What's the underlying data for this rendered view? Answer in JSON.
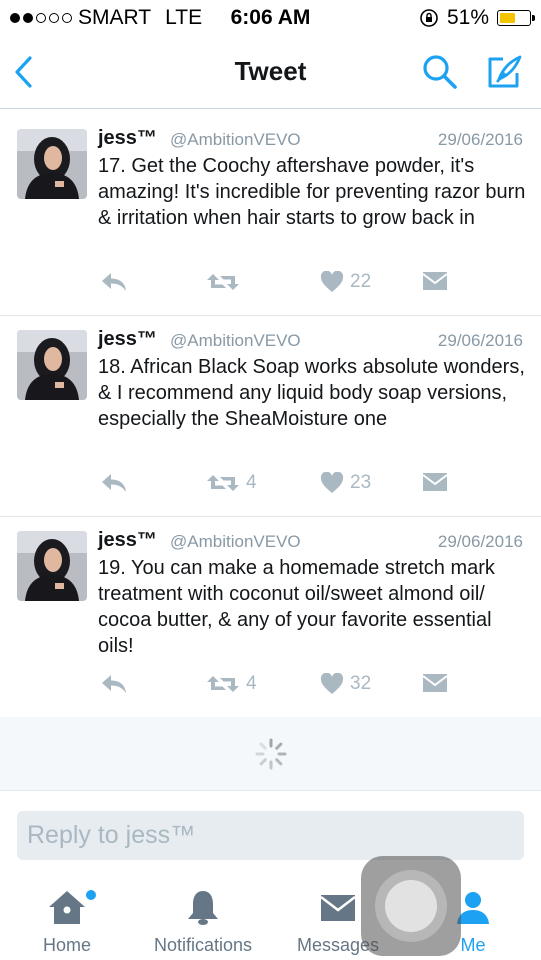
{
  "status_bar": {
    "carrier": "SMART",
    "network": "LTE",
    "time": "6:06 AM",
    "battery": "51%",
    "battery_level": 0.51,
    "signal_bars_filled": 2,
    "signal_bars_total": 5
  },
  "nav": {
    "title": "Tweet",
    "back_icon": "chevron-left-icon",
    "search_icon": "search-icon",
    "compose_icon": "compose-icon"
  },
  "tweets": [
    {
      "name": "jess™",
      "handle": "@AmbitionVEVO",
      "date": "29/06/2016",
      "text": "17. Get the Coochy aftershave powder, it's amazing! It's incredible for preventing razor burn & irritation when hair starts to grow back in",
      "retweets": "",
      "likes": "22"
    },
    {
      "name": "jess™",
      "handle": "@AmbitionVEVO",
      "date": "29/06/2016",
      "text": "18. African Black Soap works absolute wonders, & I recommend any liquid body soap versions, especially the SheaMoisture one",
      "retweets": "4",
      "likes": "23"
    },
    {
      "name": "jess™",
      "handle": "@AmbitionVEVO",
      "date": "29/06/2016",
      "text": "19. You can make a homemade stretch mark treatment with coconut oil/sweet almond oil/ cocoa butter, & any of your favorite essential oils!",
      "retweets": "4",
      "likes": "32"
    }
  ],
  "reply": {
    "placeholder": "Reply to jess™"
  },
  "tabs": [
    {
      "label": "Home",
      "icon": "home-icon"
    },
    {
      "label": "Notifications",
      "icon": "bell-icon"
    },
    {
      "label": "Messages",
      "icon": "envelope-icon"
    },
    {
      "label": "Me",
      "icon": "person-icon"
    }
  ],
  "colors": {
    "accent": "#1da1f2",
    "muted": "#aab8c2",
    "battery": "#f5c400"
  }
}
